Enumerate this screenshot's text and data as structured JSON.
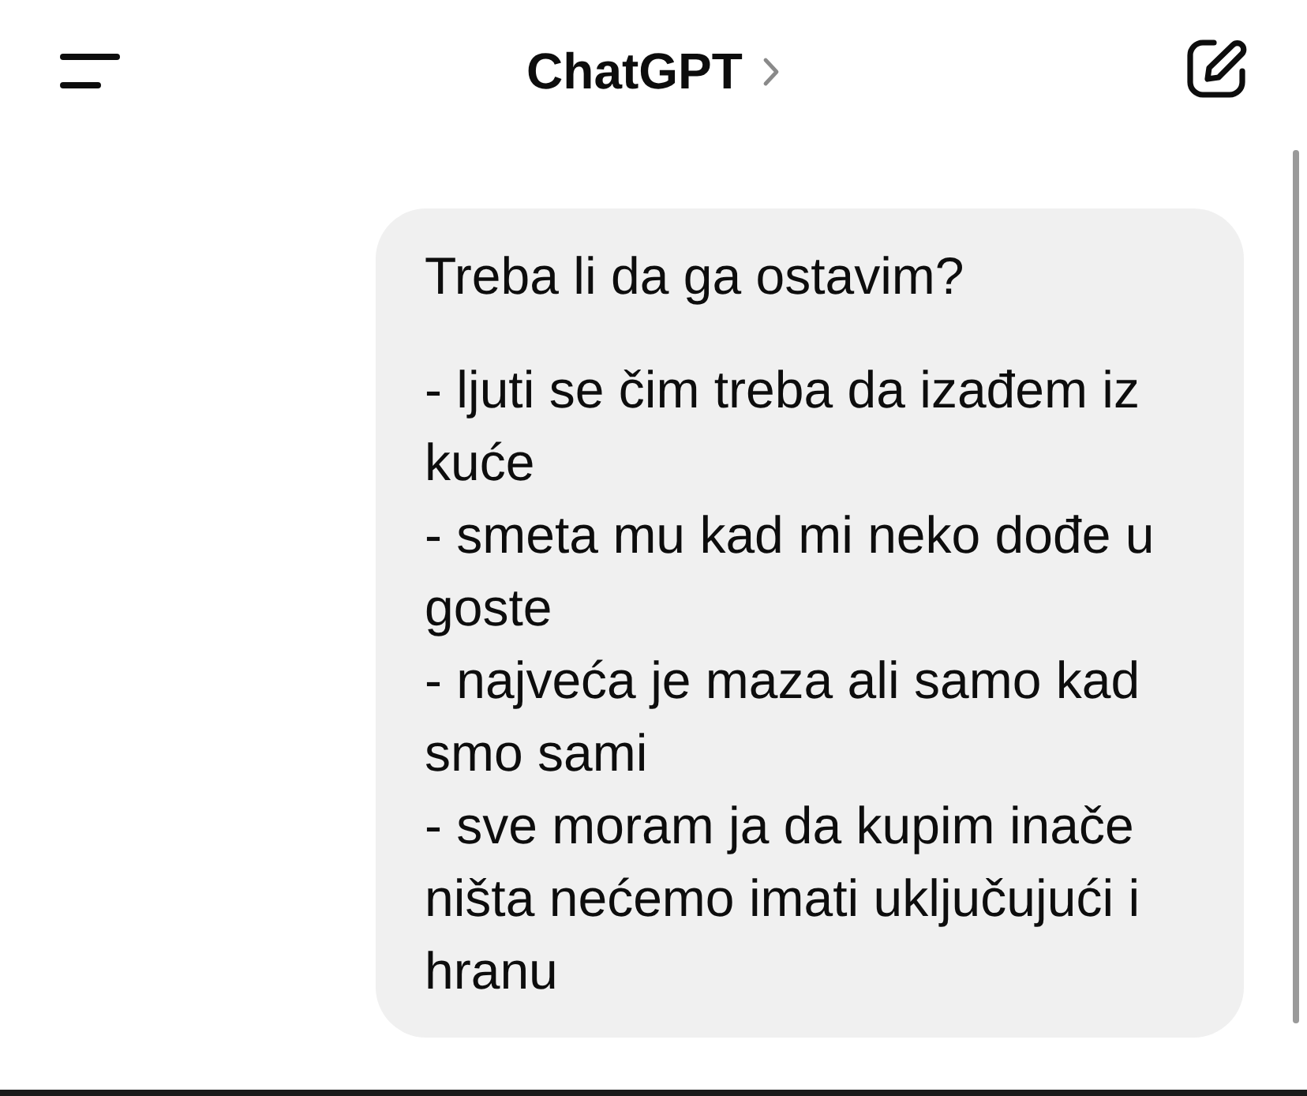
{
  "header": {
    "title": "ChatGPT"
  },
  "messages": [
    {
      "kind": "user",
      "paragraphs": [
        [
          "Treba li da ga ostavim?"
        ],
        [
          "- ljuti se čim treba da izađem iz kuće",
          "- smeta mu kad mi neko dođe u goste",
          "- najveća je maza ali samo kad smo sami",
          "- sve moram ja da kupim inače ništa nećemo imati uključujući i hranu"
        ]
      ]
    }
  ]
}
